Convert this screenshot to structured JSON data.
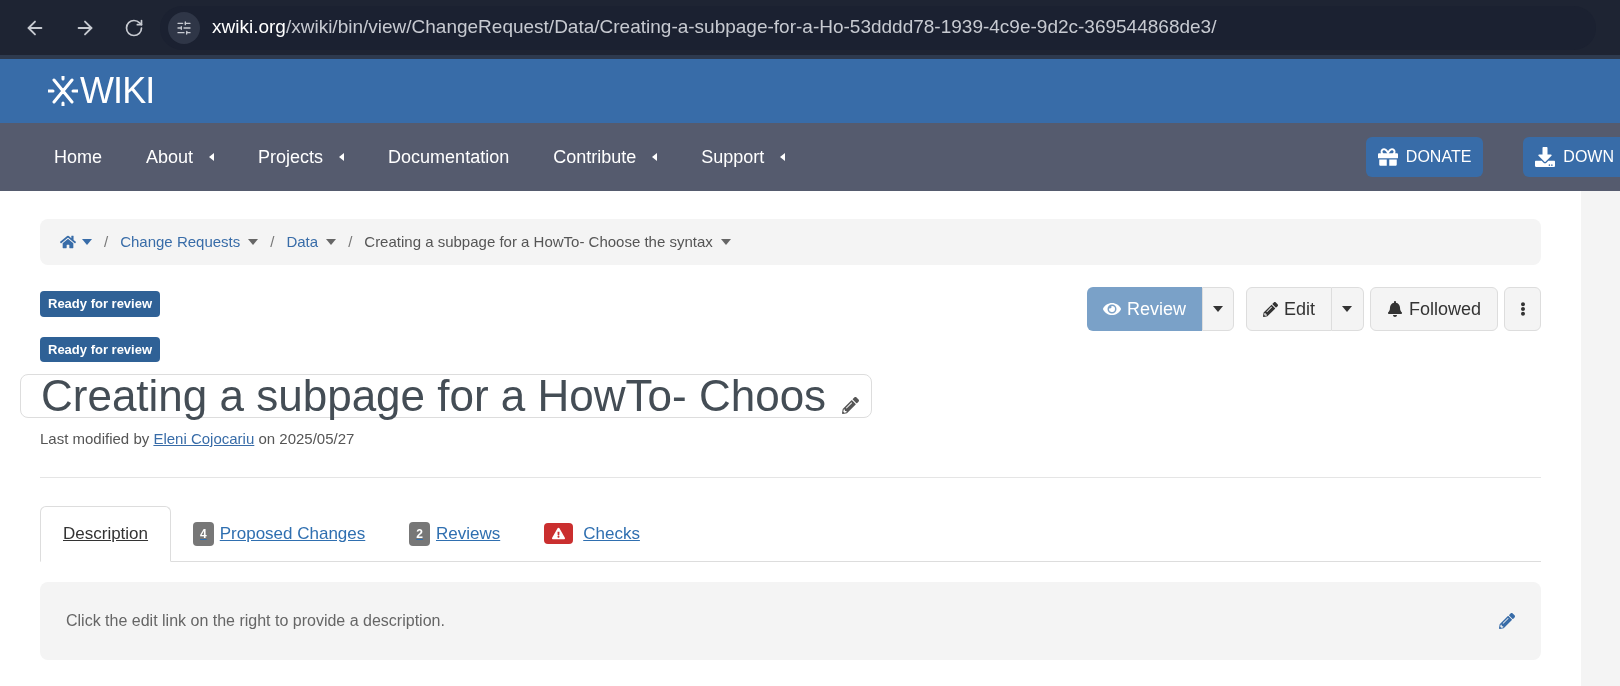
{
  "browser": {
    "url_host": "xwiki.org",
    "url_path": "/xwiki/bin/view/ChangeRequest/Data/Creating-a-subpage-for-a-Ho-53dddd78-1939-4c9e-9d2c-369544868de3/"
  },
  "header": {
    "logo": "WIKI"
  },
  "nav": {
    "items": [
      {
        "label": "Home",
        "dropdown": false
      },
      {
        "label": "About",
        "dropdown": true
      },
      {
        "label": "Projects",
        "dropdown": true
      },
      {
        "label": "Documentation",
        "dropdown": false
      },
      {
        "label": "Contribute",
        "dropdown": true
      },
      {
        "label": "Support",
        "dropdown": true
      }
    ],
    "buttons": [
      {
        "label": "DONATE",
        "kind": "gift"
      },
      {
        "label": "DOWN",
        "kind": "download"
      }
    ]
  },
  "breadcrumb": [
    {
      "separator": "/",
      "label": "Change Requests",
      "link": true
    },
    {
      "separator": "/",
      "label": "Data",
      "link": true
    },
    {
      "separator": "/",
      "label": "Creating a subpage for a HowTo- Choose the syntax",
      "link": false
    }
  ],
  "badges": [
    "Ready for review",
    "Ready for review"
  ],
  "actions": {
    "review": "Review",
    "review_disabled": true,
    "edit": "Edit",
    "followed": "Followed"
  },
  "title": "Creating a subpage for a HowTo- Choos",
  "meta": {
    "prefix": "Last modified by",
    "author": "Eleni Cojocariu",
    "suffix": "on 2025/05/27"
  },
  "tabs": [
    {
      "label": "Description",
      "selected": true,
      "kind": "plain"
    },
    {
      "label": "Proposed Changes",
      "selected": false,
      "kind": "count",
      "badge": "4"
    },
    {
      "label": "Reviews",
      "selected": false,
      "kind": "count",
      "badge": "2"
    },
    {
      "label": "Checks",
      "selected": false,
      "kind": "warning"
    }
  ],
  "description": "Click the edit link on the right to provide a description."
}
